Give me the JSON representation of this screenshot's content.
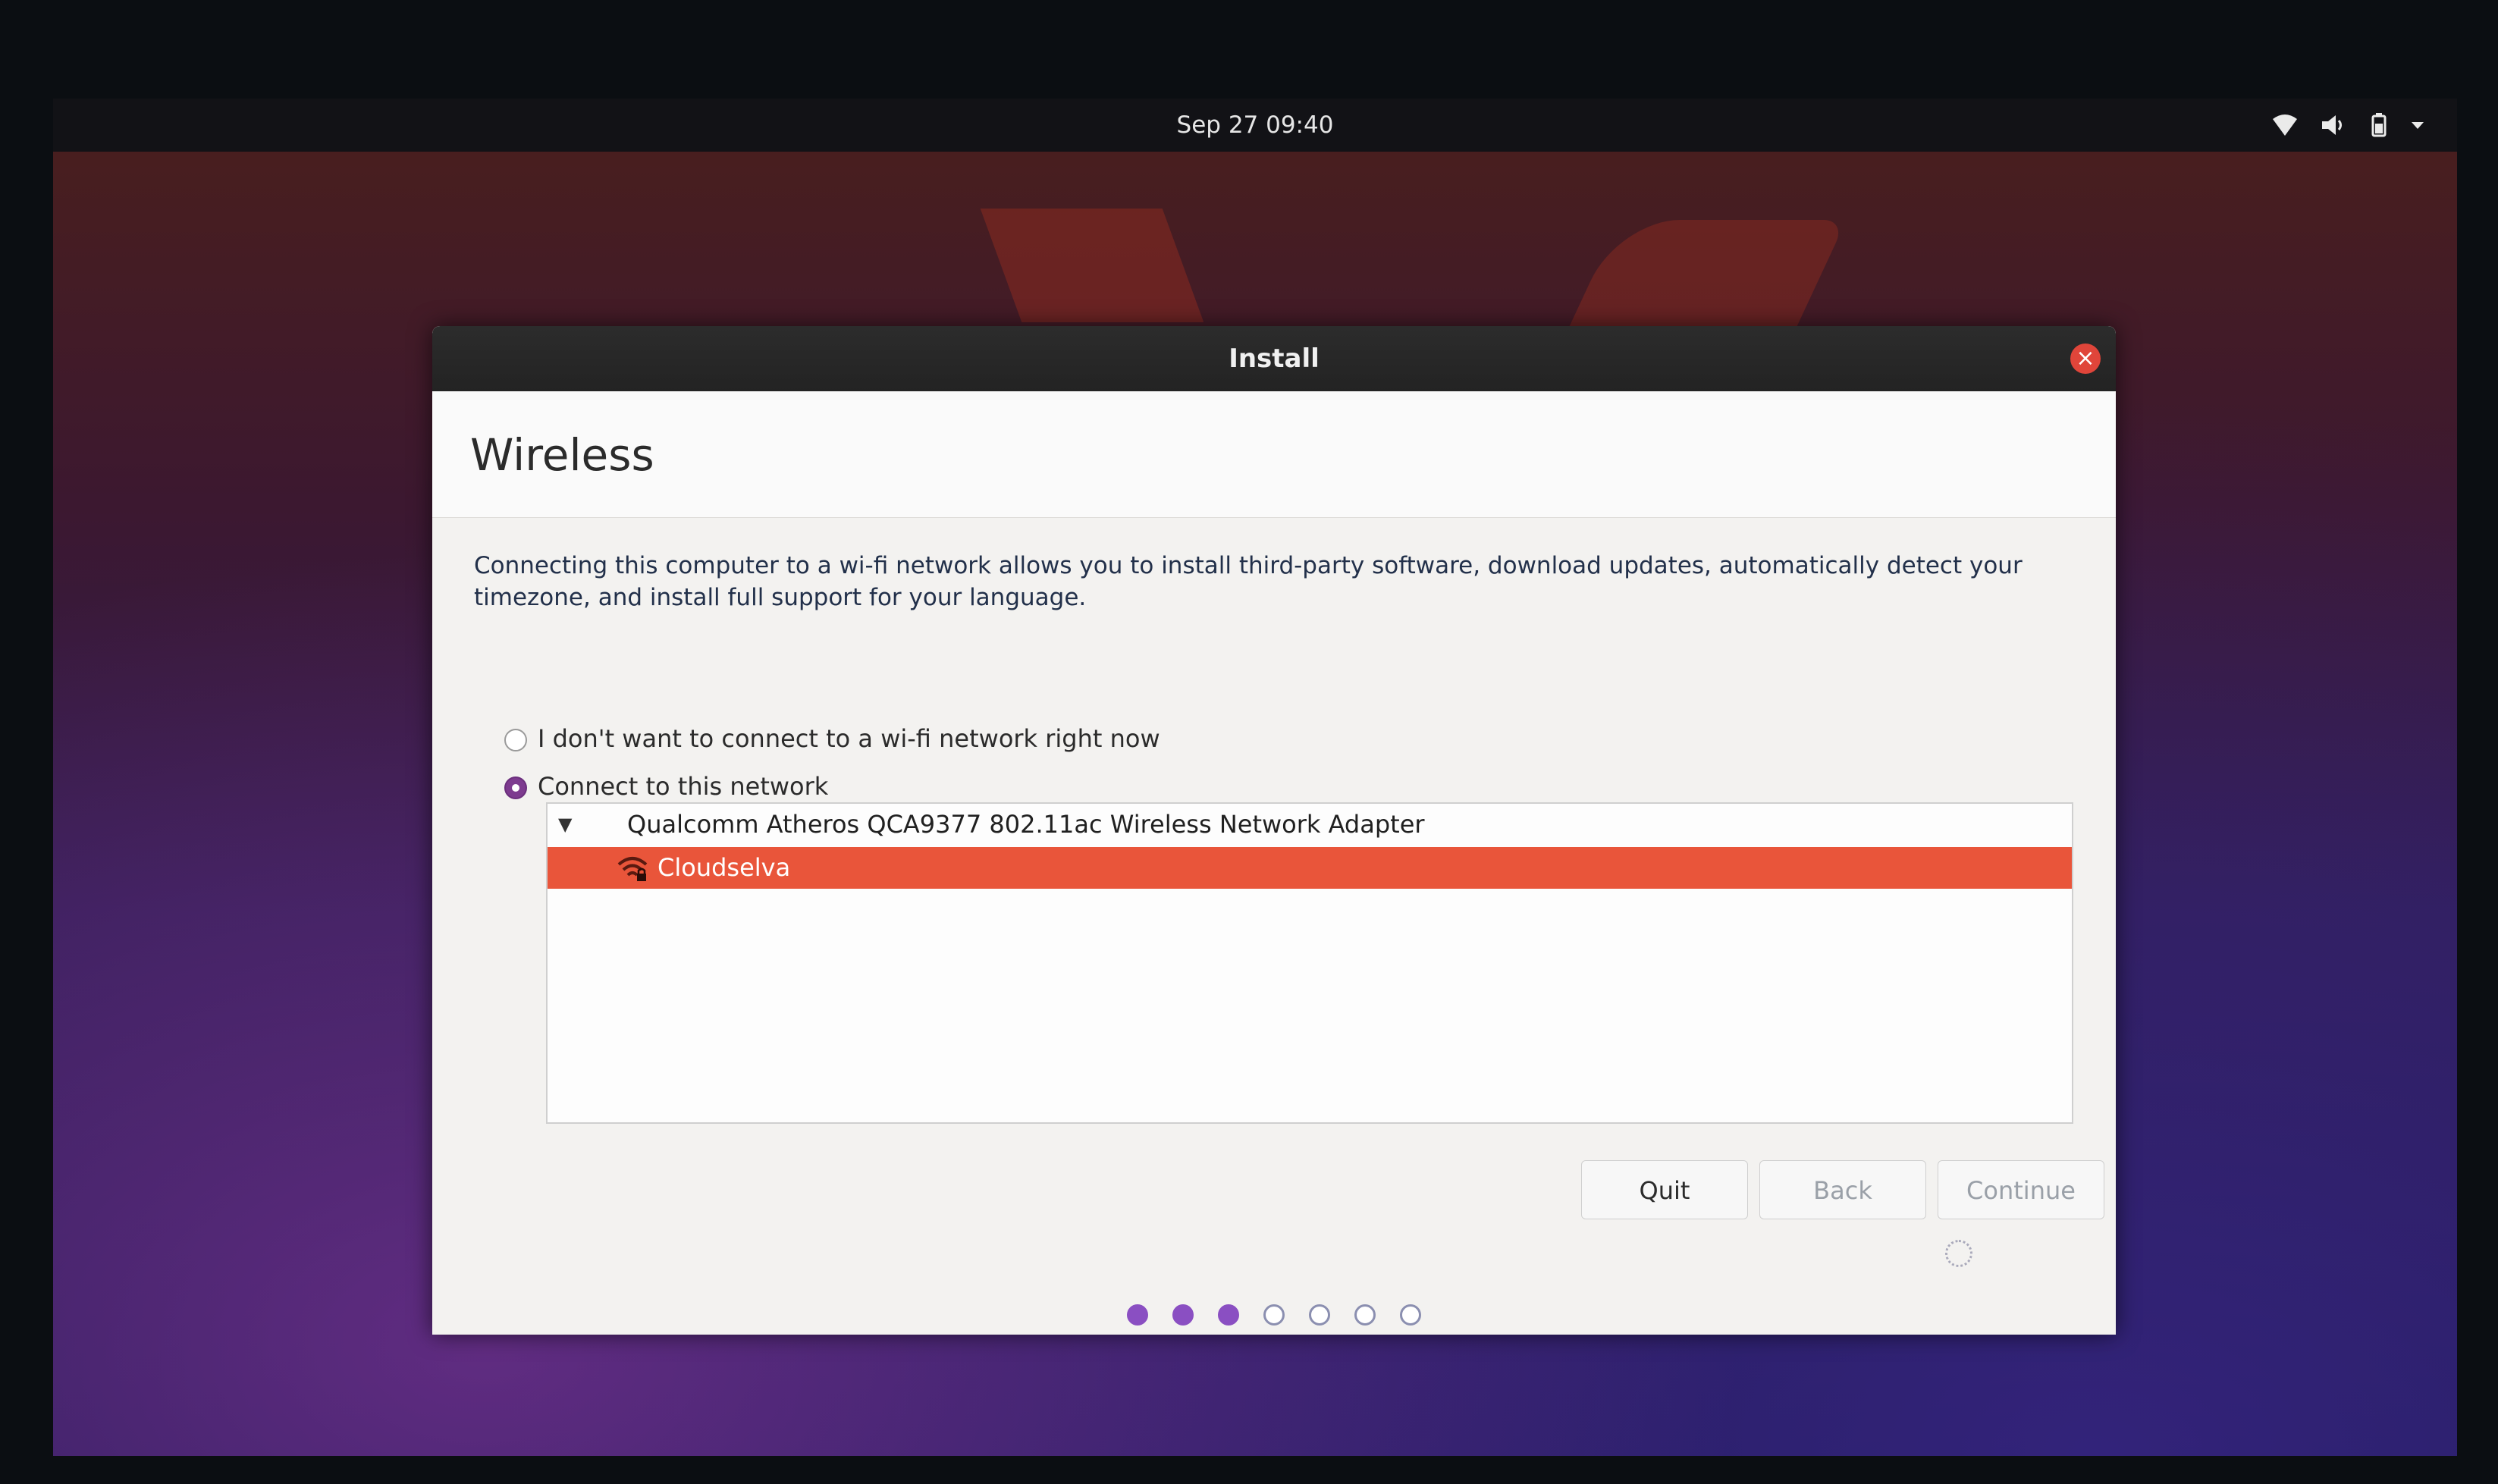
{
  "topbar": {
    "clock": "Sep 27  09:40",
    "tray_icons": [
      "wifi-icon",
      "volume-icon",
      "battery-icon",
      "chevron-down-icon"
    ]
  },
  "window": {
    "title": "Install",
    "close_icon": "close-icon"
  },
  "page": {
    "title": "Wireless",
    "description": "Connecting this computer to a wi-fi network allows you to install third-party software, download updates, automatically detect your timezone, and install full support for your language.",
    "options": [
      {
        "label": "I don't want to connect to a wi-fi network right now",
        "selected": false
      },
      {
        "label": "Connect to this network",
        "selected": true
      }
    ]
  },
  "network_list": {
    "adapter": "Qualcomm Atheros QCA9377 802.11ac Wireless Network Adapter",
    "networks": [
      {
        "name": "Cloudselva",
        "selected": true,
        "secured": true,
        "icon": "wifi-lock-icon"
      }
    ]
  },
  "buttons": {
    "quit": "Quit",
    "back": "Back",
    "continue": "Continue"
  },
  "progress": {
    "total_steps": 7,
    "completed_steps": 3
  },
  "colors": {
    "accent": "#e9553a",
    "radio_on": "#7d3b8f",
    "progress_done": "#8a4fc2"
  }
}
